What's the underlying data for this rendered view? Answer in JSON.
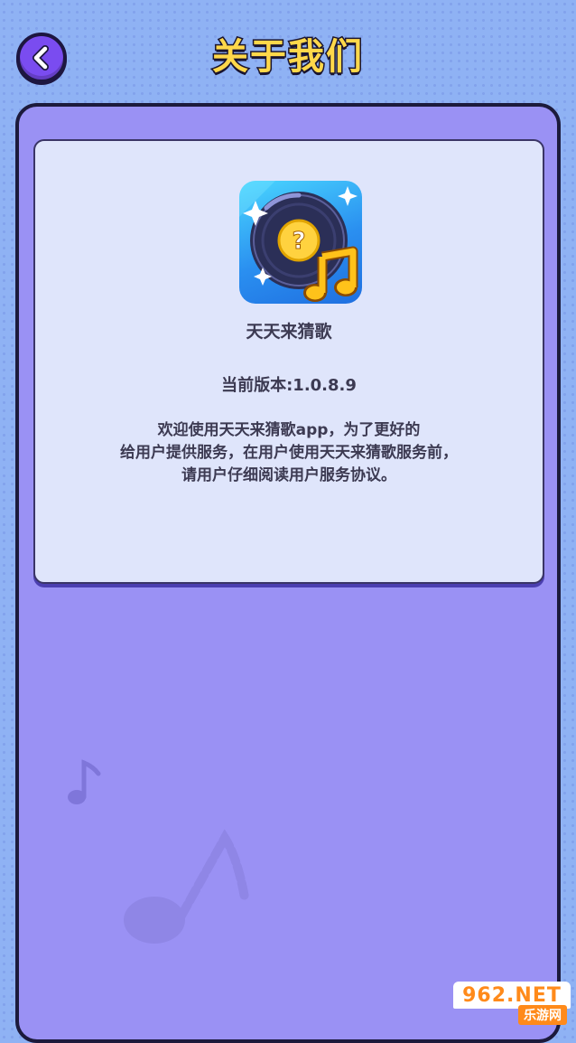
{
  "header": {
    "title": "关于我们",
    "back_icon": "chevron-left-icon"
  },
  "app": {
    "name": "天天来猜歌",
    "icon": "vinyl-record-question-music-note-icon",
    "version_line": "当前版本:1.0.8.9"
  },
  "intro": {
    "lines": [
      "欢迎使用天天来猜歌app，为了更好的",
      "给用户提供服务，在用户使用天天来猜歌服务前，",
      "请用户仔细阅读用户服务协议。"
    ]
  },
  "watermark": {
    "brand": "962.NET",
    "sub": "乐游网"
  },
  "colors": {
    "background": "#8fb2f4",
    "panel": "#9a91f4",
    "card": "#dfe5fb",
    "title": "#ffd84a",
    "back_button": "#7a4cf0"
  }
}
